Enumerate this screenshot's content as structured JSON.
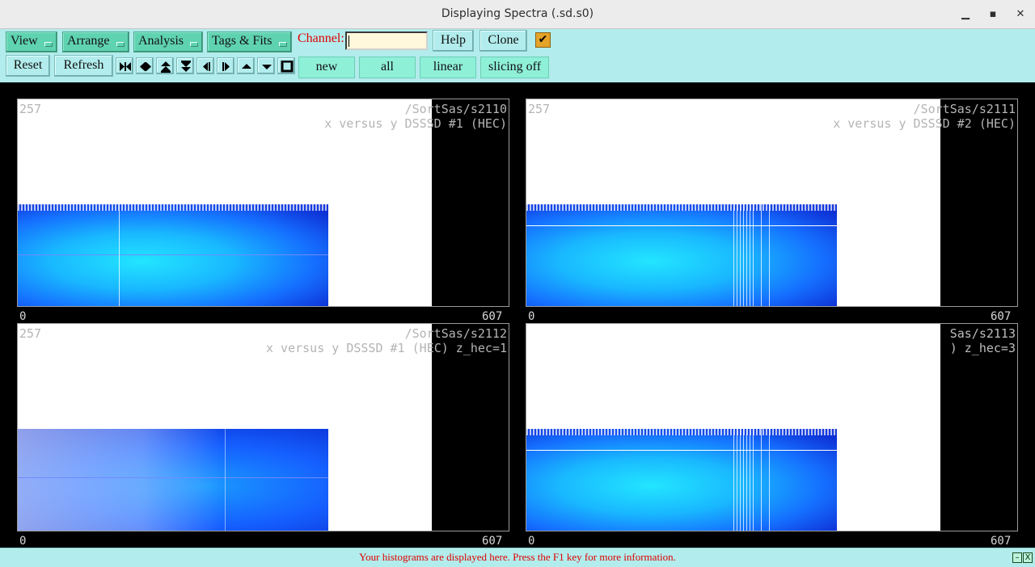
{
  "window": {
    "title": "Displaying Spectra (.sd.s0)",
    "minimize_glyph": "▁",
    "maximize_glyph": "▪",
    "close_glyph": "✕"
  },
  "toolbar": {
    "menus": [
      "View",
      "Arrange",
      "Analysis",
      "Tags & Fits"
    ],
    "channel_label": "Channel:",
    "channel_value": "",
    "help": "Help",
    "clone": "Clone",
    "checkbox_glyph": "✔",
    "reset": "Reset",
    "refresh": "Refresh",
    "new": "new",
    "all": "all",
    "linear": "linear",
    "slicing": "slicing off",
    "nav_icons": [
      "first-icon",
      "expand-horizontal-icon",
      "expand-up-icon",
      "expand-down-icon",
      "prev-icon",
      "next-icon",
      "up-icon",
      "down-icon",
      "stop-icon"
    ]
  },
  "panels": [
    {
      "y_max": "257",
      "path": "/SortSas/s2110",
      "subtitle": "x versus y DSSSD #1 (HEC)",
      "x_min": "0",
      "x_max": "607"
    },
    {
      "y_max": "257",
      "path": "/SortSas/s2111",
      "subtitle": "x versus y DSSSD #2 (HEC)",
      "x_min": "0",
      "x_max": "607"
    },
    {
      "y_max": "257",
      "path": "/SortSas/s2112",
      "subtitle": "x versus y DSSSD #1 (HEC) z_hec=1",
      "x_min": "0",
      "x_max": "607"
    },
    {
      "y_max": "",
      "path": "Sas/s2113",
      "subtitle": ") z_hec=3",
      "x_min": "0",
      "x_max": "607"
    }
  ],
  "status": {
    "message": "Your histograms are displayed here. Press the F1 key for more information.",
    "minimize_glyph": "–",
    "close_glyph": "X"
  },
  "colors": {
    "toolbar_bg": "#b2ecec",
    "menu_bg": "#5fd3b0",
    "channel_label": "#e10000",
    "status_text": "#e10000",
    "checkbox": "#e4a329"
  }
}
